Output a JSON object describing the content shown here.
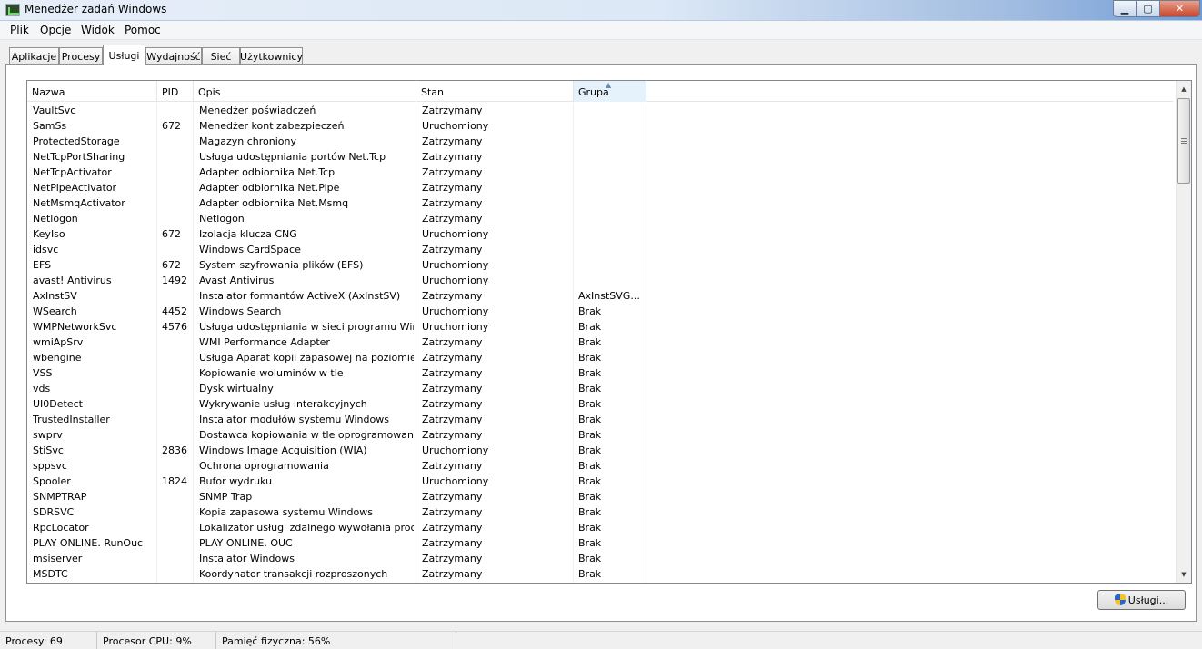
{
  "window": {
    "title": "Menedżer zadań Windows"
  },
  "menu": [
    "Plik",
    "Opcje",
    "Widok",
    "Pomoc"
  ],
  "tabs": [
    "Aplikacje",
    "Procesy",
    "Usługi",
    "Wydajność",
    "Sieć",
    "Użytkownicy"
  ],
  "active_tab": "Usługi",
  "columns": [
    "Nazwa",
    "PID",
    "Opis",
    "Stan",
    "Grupa"
  ],
  "sorted_column": "Grupa",
  "rows": [
    [
      "VaultSvc",
      "",
      "Menedżer poświadczeń",
      "Zatrzymany",
      ""
    ],
    [
      "SamSs",
      "672",
      "Menedżer kont zabezpieczeń",
      "Uruchomiony",
      ""
    ],
    [
      "ProtectedStorage",
      "",
      "Magazyn chroniony",
      "Zatrzymany",
      ""
    ],
    [
      "NetTcpPortSharing",
      "",
      "Usługa udostępniania portów Net.Tcp",
      "Zatrzymany",
      ""
    ],
    [
      "NetTcpActivator",
      "",
      "Adapter odbiornika Net.Tcp",
      "Zatrzymany",
      ""
    ],
    [
      "NetPipeActivator",
      "",
      "Adapter odbiornika Net.Pipe",
      "Zatrzymany",
      ""
    ],
    [
      "NetMsmqActivator",
      "",
      "Adapter odbiornika Net.Msmq",
      "Zatrzymany",
      ""
    ],
    [
      "Netlogon",
      "",
      "Netlogon",
      "Zatrzymany",
      ""
    ],
    [
      "KeyIso",
      "672",
      "Izolacja klucza CNG",
      "Uruchomiony",
      ""
    ],
    [
      "idsvc",
      "",
      "Windows CardSpace",
      "Zatrzymany",
      ""
    ],
    [
      "EFS",
      "672",
      "System szyfrowania plików (EFS)",
      "Uruchomiony",
      ""
    ],
    [
      "avast! Antivirus",
      "1492",
      "Avast Antivirus",
      "Uruchomiony",
      ""
    ],
    [
      "AxInstSV",
      "",
      "Instalator formantów ActiveX (AxInstSV)",
      "Zatrzymany",
      "AxInstSVG..."
    ],
    [
      "WSearch",
      "4452",
      "Windows Search",
      "Uruchomiony",
      "Brak"
    ],
    [
      "WMPNetworkSvc",
      "4576",
      "Usługa udostępniania w sieci programu Windo...",
      "Uruchomiony",
      "Brak"
    ],
    [
      "wmiApSrv",
      "",
      "WMI Performance Adapter",
      "Zatrzymany",
      "Brak"
    ],
    [
      "wbengine",
      "",
      "Usługa Aparat kopii zapasowej na poziomie bl...",
      "Zatrzymany",
      "Brak"
    ],
    [
      "VSS",
      "",
      "Kopiowanie woluminów w tle",
      "Zatrzymany",
      "Brak"
    ],
    [
      "vds",
      "",
      "Dysk wirtualny",
      "Zatrzymany",
      "Brak"
    ],
    [
      "UI0Detect",
      "",
      "Wykrywanie usług interakcyjnych",
      "Zatrzymany",
      "Brak"
    ],
    [
      "TrustedInstaller",
      "",
      "Instalator modułów systemu Windows",
      "Zatrzymany",
      "Brak"
    ],
    [
      "swprv",
      "",
      "Dostawca kopiowania w tle oprogramowania f...",
      "Zatrzymany",
      "Brak"
    ],
    [
      "StiSvc",
      "2836",
      "Windows Image Acquisition (WIA)",
      "Uruchomiony",
      "Brak"
    ],
    [
      "sppsvc",
      "",
      "Ochrona oprogramowania",
      "Zatrzymany",
      "Brak"
    ],
    [
      "Spooler",
      "1824",
      "Bufor wydruku",
      "Uruchomiony",
      "Brak"
    ],
    [
      "SNMPTRAP",
      "",
      "SNMP Trap",
      "Zatrzymany",
      "Brak"
    ],
    [
      "SDRSVC",
      "",
      "Kopia zapasowa systemu Windows",
      "Zatrzymany",
      "Brak"
    ],
    [
      "RpcLocator",
      "",
      "Lokalizator usługi zdalnego wywołania proced...",
      "Zatrzymany",
      "Brak"
    ],
    [
      "PLAY ONLINE. RunOuc",
      "",
      "PLAY ONLINE. OUC",
      "Zatrzymany",
      "Brak"
    ],
    [
      "msiserver",
      "",
      "Instalator Windows",
      "Zatrzymany",
      "Brak"
    ],
    [
      "MSDTC",
      "",
      "Koordynator transakcji rozproszonych",
      "Zatrzymany",
      "Brak"
    ]
  ],
  "services_button": "Usługi...",
  "status": {
    "processes": "Procesy: 69",
    "cpu": "Procesor CPU: 9%",
    "memory": "Pamięć fizyczna: 56%"
  },
  "icons": {
    "app": "task-manager-icon",
    "button": "uac-shield-icon"
  }
}
